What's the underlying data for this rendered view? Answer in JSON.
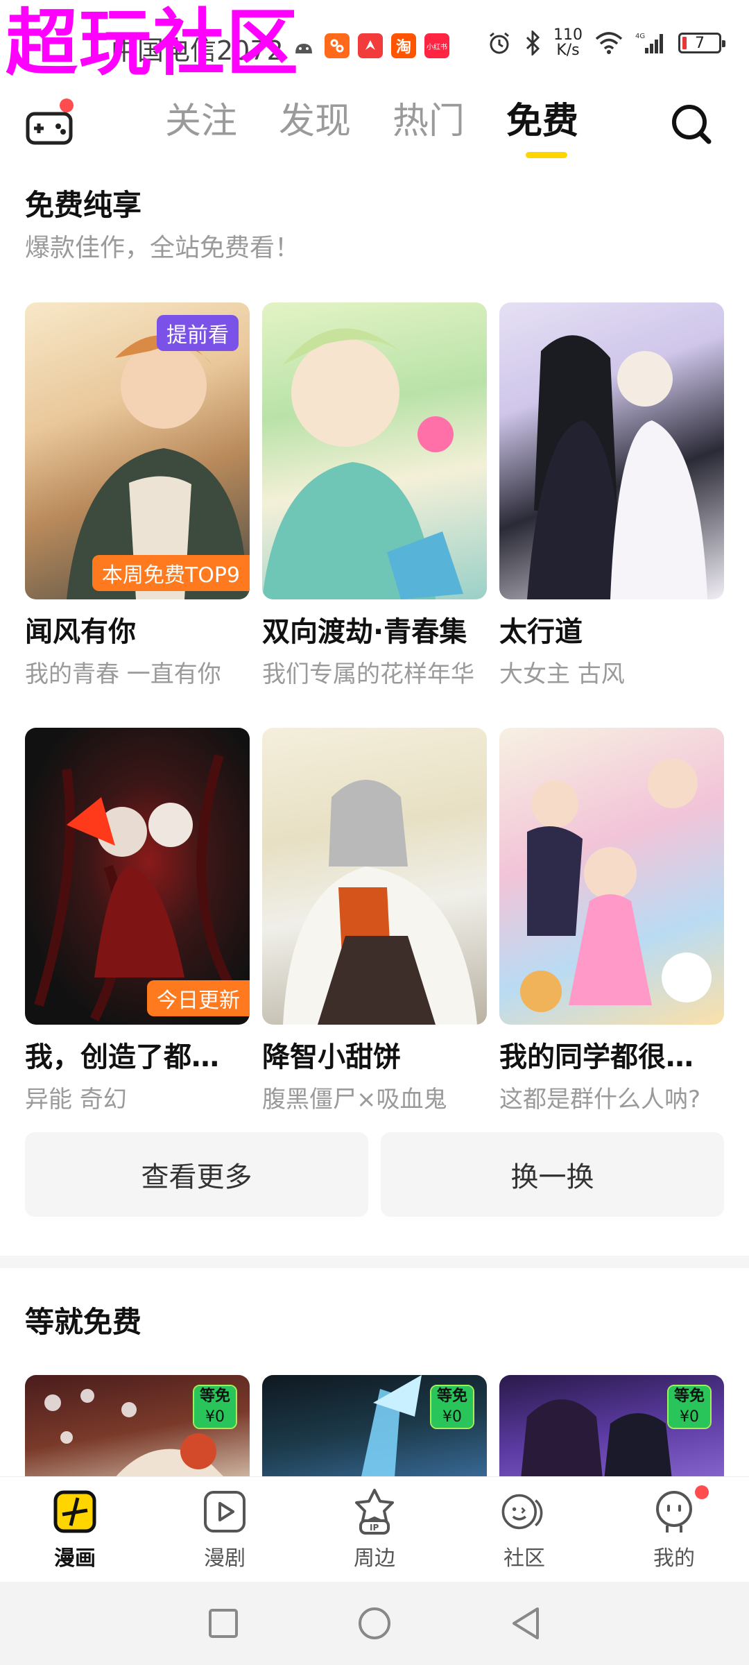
{
  "status_bar": {
    "watermark": "超玩社区",
    "carrier": "中国电信2072",
    "app_icons": [
      {
        "name": "android-icon",
        "color": "#555555"
      },
      {
        "name": "app-orange-icon",
        "color": "#ff6a1a"
      },
      {
        "name": "app-red-icon",
        "color": "#f23c3c"
      },
      {
        "name": "taobao-icon",
        "color": "#ff5500",
        "label": "淘"
      },
      {
        "name": "xiaohongshu-icon",
        "color": "#ff2442",
        "label": "小红书"
      }
    ],
    "net_speed_value": "110",
    "net_speed_unit": "K/s",
    "battery_level": "7"
  },
  "top_nav": {
    "tabs": [
      {
        "label": "关注",
        "active": false
      },
      {
        "label": "发现",
        "active": false
      },
      {
        "label": "热门",
        "active": false
      },
      {
        "label": "免费",
        "active": true
      }
    ],
    "accent_color": "#ffd500"
  },
  "free_section": {
    "title": "免费纯享",
    "subtitle": "爆款佳作，全站免费看！",
    "comics": [
      {
        "title": "闻风有你",
        "subtitle": "我的青春 一直有你",
        "badge_top": "提前看",
        "badge_bottom": "本周免费TOP9"
      },
      {
        "title": "双向渡劫·青春集",
        "subtitle": "我们专属的花样年华",
        "badge_top": "",
        "badge_bottom": ""
      },
      {
        "title": "太行道",
        "subtitle": "大女主 古风",
        "badge_top": "",
        "badge_bottom": ""
      },
      {
        "title": "我，创造了都…",
        "subtitle": "异能 奇幻",
        "badge_top": "",
        "badge_bottom": "今日更新"
      },
      {
        "title": "降智小甜饼",
        "subtitle": "腹黑僵尸×吸血鬼",
        "badge_top": "",
        "badge_bottom": ""
      },
      {
        "title": "我的同学都很…",
        "subtitle": "这都是群什么人呐?",
        "badge_top": "",
        "badge_bottom": ""
      }
    ],
    "more_button": "查看更多",
    "refresh_button": "换一换"
  },
  "wait_section": {
    "title": "等就免费",
    "badge_top": "等免",
    "badge_bottom": "¥0"
  },
  "bottom_nav": {
    "items": [
      {
        "label": "漫画",
        "icon": "comic-icon",
        "active": true
      },
      {
        "label": "漫剧",
        "icon": "video-play-icon",
        "active": false
      },
      {
        "label": "周边",
        "icon": "ip-merch-icon",
        "active": false
      },
      {
        "label": "社区",
        "icon": "community-icon",
        "active": false
      },
      {
        "label": "我的",
        "icon": "profile-icon",
        "active": false
      }
    ]
  }
}
